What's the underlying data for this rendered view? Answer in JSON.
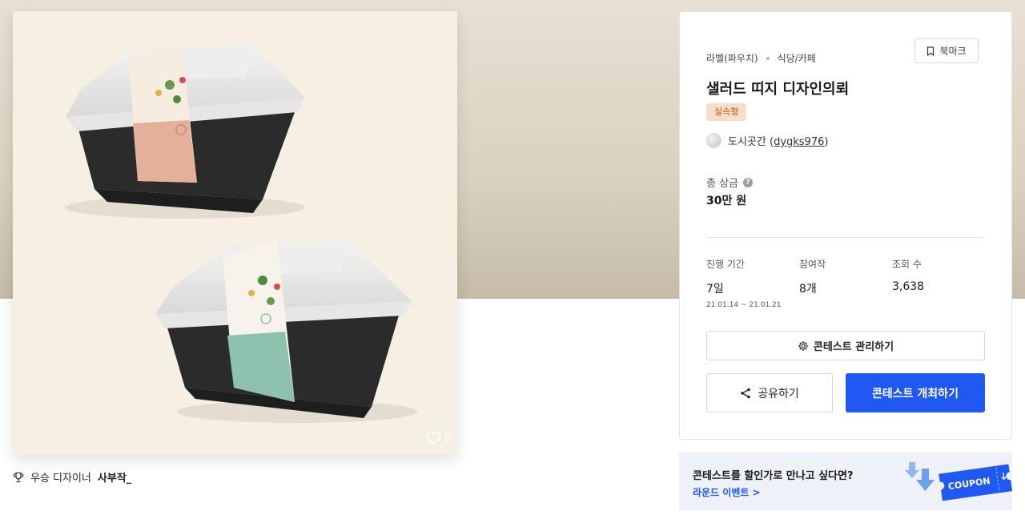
{
  "contest": {
    "category_primary": "라벨(파우치)",
    "category_secondary": "식당/카페",
    "bookmark_label": "북마크",
    "title": "샐러드 띠지 디자인의뢰",
    "badge": "실속형",
    "designer_name": "도시곳간",
    "designer_id_open": " (",
    "designer_id": "dygks976",
    "designer_id_close": ")",
    "prize_label": "총 상금",
    "prize_value": "30만 원"
  },
  "stats": [
    {
      "label": "진행 기간",
      "value": "7일",
      "sub": "21.01.14 ~ 21.01.21"
    },
    {
      "label": "참여작",
      "value": "8개"
    },
    {
      "label": "조회 수",
      "value": "3,638"
    }
  ],
  "actions": {
    "manage_label": "콘테스트 관리하기",
    "share_label": "공유하기",
    "host_label": "콘테스트 개최하기"
  },
  "image": {
    "like_count": "6",
    "winner_prefix": "우승 디자이너",
    "winner_name": "사부작_"
  },
  "banner": {
    "question": "콘테스트를 할인가로 만나고 싶다면?",
    "link_label": "라운드 이벤트 >",
    "coupon_text": "COUPON"
  },
  "colors": {
    "accent": "#2058f2",
    "badge_bg": "#f7dec9",
    "badge_text": "#b75b1c",
    "label_pink": "#e5b09b",
    "label_mint": "#8ec1ae"
  }
}
